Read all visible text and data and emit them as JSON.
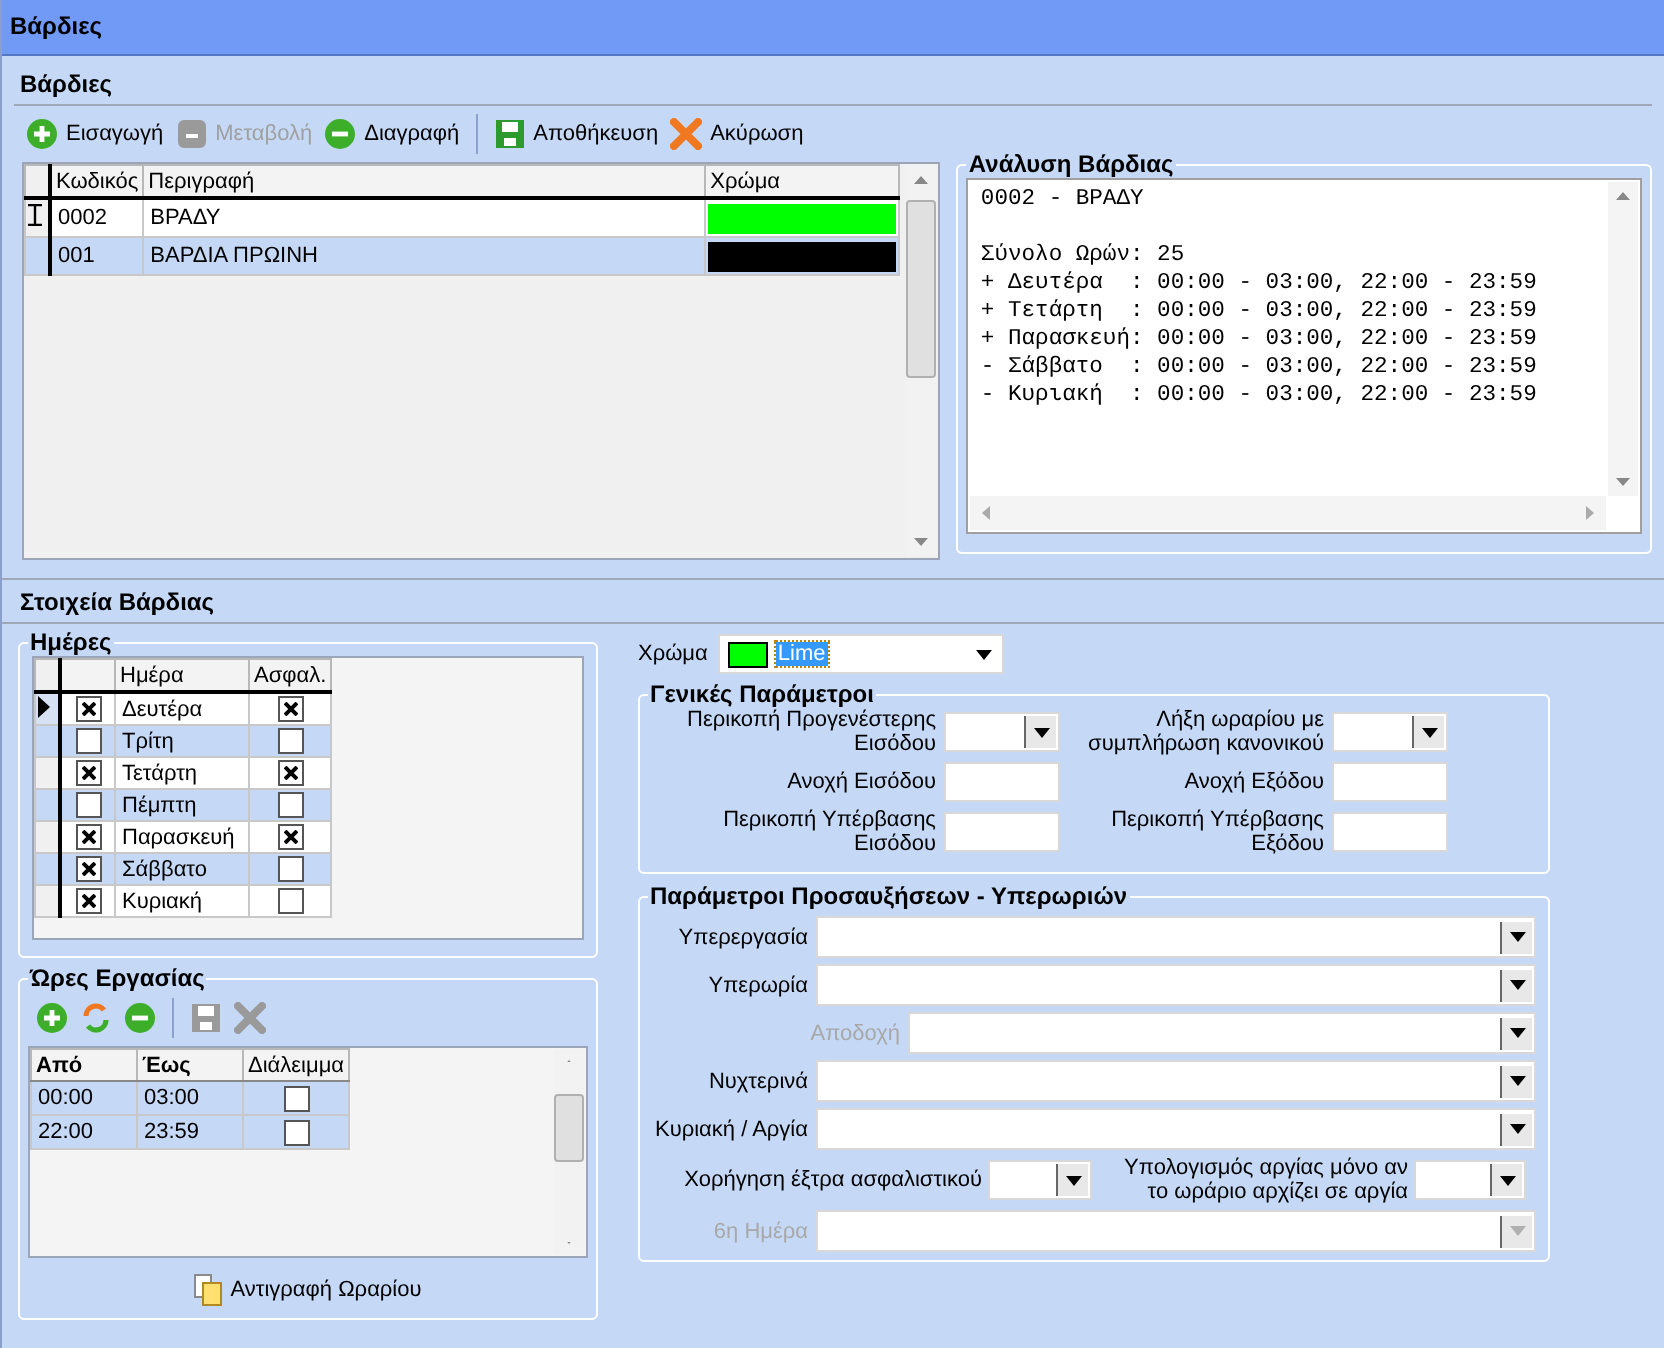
{
  "window": {
    "title": "Βάρδιες"
  },
  "shifts": {
    "title": "Βάρδιες",
    "toolbar": [
      {
        "kind": "add",
        "label": "Εισαγωγή",
        "disabled": false
      },
      {
        "kind": "edit",
        "label": "Μεταβολή",
        "disabled": true
      },
      {
        "kind": "delete",
        "label": "Διαγραφή",
        "disabled": false
      },
      {
        "kind": "save",
        "label": "Αποθήκευση",
        "disabled": false
      },
      {
        "kind": "cancel",
        "label": "Ακύρωση",
        "disabled": false
      }
    ],
    "table": {
      "columns": [
        "Κωδικός",
        "Περιγραφή",
        "Χρώμα"
      ],
      "rows": [
        {
          "code": "0002",
          "description": "ΒΡΑΔΥ",
          "color": "#00ff00",
          "selected": true
        },
        {
          "code": "001",
          "description": "ΒΑΡΔΙΑ ΠΡΩΙΝΗ",
          "color": "#000000",
          "selected": false
        }
      ]
    },
    "analysis": {
      "title": "Ανάλυση Βάρδιας",
      "heading": "0002 - ΒΡΑΔΥ",
      "total": "Σύνολο Ωρών: 25",
      "lines": [
        "+ Δευτέρα  : 00:00 - 03:00, 22:00 - 23:59",
        "+ Τετάρτη  : 00:00 - 03:00, 22:00 - 23:59",
        "+ Παρασκευή: 00:00 - 03:00, 22:00 - 23:59",
        "- Σάββατο  : 00:00 - 03:00, 22:00 - 23:59",
        "- Κυριακή  : 00:00 - 03:00, 22:00 - 23:59"
      ]
    }
  },
  "details": {
    "title": "Στοιχεία Βάρδιας",
    "days": {
      "title": "Ημέρες",
      "columns": [
        "Ημέρα",
        "Ασφαλ."
      ],
      "rows": [
        {
          "name": "Δευτέρα",
          "checked": true,
          "insured": true,
          "selected": true
        },
        {
          "name": "Τρίτη",
          "checked": false,
          "insured": false,
          "selected": false
        },
        {
          "name": "Τετάρτη",
          "checked": true,
          "insured": true,
          "selected": false
        },
        {
          "name": "Πέμπτη",
          "checked": false,
          "insured": false,
          "selected": false
        },
        {
          "name": "Παρασκευή",
          "checked": true,
          "insured": true,
          "selected": false
        },
        {
          "name": "Σάββατο",
          "checked": true,
          "insured": false,
          "selected": false
        },
        {
          "name": "Κυριακή",
          "checked": true,
          "insured": false,
          "selected": false
        }
      ]
    },
    "hours": {
      "title": "Ώρες Εργασίας",
      "tools": [
        {
          "kind": "add",
          "disabled": false
        },
        {
          "kind": "refresh",
          "disabled": false
        },
        {
          "kind": "delete",
          "disabled": false
        },
        {
          "kind": "save",
          "disabled": true
        },
        {
          "kind": "cancel",
          "disabled": true
        }
      ],
      "columns": [
        "Από",
        "Έως",
        "Διάλειμμα"
      ],
      "rows": [
        {
          "from": "00:00",
          "to": "03:00",
          "break": false
        },
        {
          "from": "22:00",
          "to": "23:59",
          "break": false
        }
      ],
      "copy_button": "Αντιγραφή Ωραρίου"
    },
    "color": {
      "label": "Χρώμα",
      "value": "Lime",
      "color": "#00ff00"
    },
    "general": {
      "title": "Γενικές Παράμετροι",
      "rows": [
        [
          {
            "label": "Περικοπή Προγενέστερης Εισόδου",
            "kind": "combo"
          },
          {
            "label": "Λήξη ωραρίου με συμπλήρωση κανονικού",
            "kind": "combo"
          }
        ],
        [
          {
            "label": "Ανοχή Εισόδου",
            "kind": "text"
          },
          {
            "label": "Ανοχή Εξόδου",
            "kind": "text"
          }
        ],
        [
          {
            "label": "Περικοπή Υπέρβασης Εισόδου",
            "kind": "text"
          },
          {
            "label": "Περικοπή Υπέρβασης Εξόδου",
            "kind": "text"
          }
        ]
      ]
    },
    "overtime": {
      "title": "Παράμετροι Προσαυξήσεων - Υπερωριών",
      "rows": [
        {
          "kind": "wide",
          "label": "Υπερεργασία",
          "disabled": false
        },
        {
          "kind": "wide",
          "label": "Υπερωρία",
          "disabled": false
        },
        {
          "kind": "sub",
          "label": "Αποδοχή",
          "disabled": true
        },
        {
          "kind": "wide",
          "label": "Νυχτερινά",
          "disabled": false
        },
        {
          "kind": "wide",
          "label": "Κυριακή / Αργία",
          "disabled": false
        },
        {
          "kind": "pair",
          "disabled": false,
          "items": [
            {
              "label": "Χορήγηση έξτρα ασφαλιστικού"
            },
            {
              "label": "Υπολογισμός αργίας μόνο αν το ωράριο αρχίζει σε αργία"
            }
          ]
        },
        {
          "kind": "wide",
          "label": "6η Ημέρα",
          "disabled": true
        }
      ]
    }
  }
}
